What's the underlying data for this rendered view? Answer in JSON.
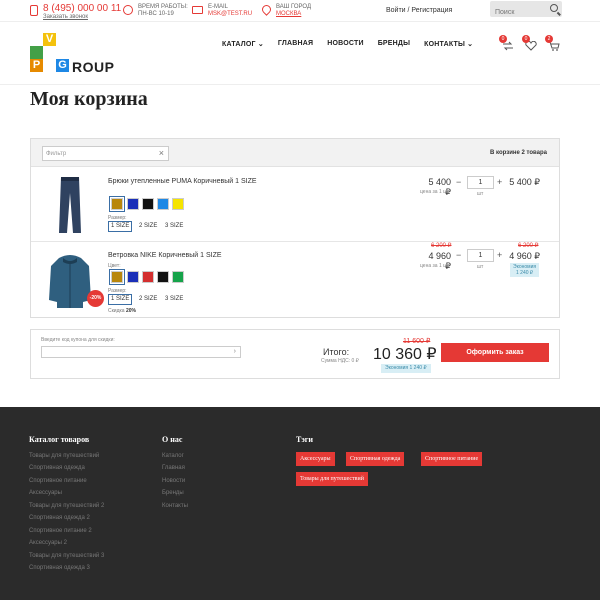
{
  "topbar": {
    "phone": "8 (495) 000 00 11",
    "callback": "Заказать звонок",
    "hours_label": "ВРЕМЯ РАБОТЫ:",
    "hours_value": "ПН-ВС 10-19",
    "email_label": "E-MAIL",
    "email_value": "MSK@TEST.RU",
    "city_label": "ВАШ ГОРОД",
    "city_value": "МОСКВА",
    "login": "Войти / Регистрация",
    "search_placeholder": "Поиск"
  },
  "logo": {
    "letters": [
      "V",
      "P",
      "G"
    ],
    "rest": "ROUP",
    "colors": [
      "#f4c20d",
      "#e68a00",
      "#1e88e5",
      "#43a047"
    ]
  },
  "nav": [
    "КАТАЛОГ",
    "ГЛАВНАЯ",
    "НОВОСТИ",
    "БРЕНДЫ",
    "КОНТАКТЫ"
  ],
  "header_icons": {
    "compare_count": "0",
    "wishlist_count": "0",
    "cart_count": "2"
  },
  "page": {
    "title": "Моя корзина"
  },
  "cart": {
    "filter_placeholder": "Фильтр",
    "count_label": "В корзине 2 товара",
    "color_label": "Цвет:",
    "size_label": "Размер:",
    "items": [
      {
        "name": "Брюки утепленные PUMA Коричневый 1 SIZE",
        "colors": [
          "#b8860b",
          "#1a2fb8",
          "#111111",
          "#1e88e5",
          "#f5e400"
        ],
        "sizes": [
          "1 SIZE",
          "2 SIZE",
          "3 SIZE"
        ],
        "price": "5 400 ₽",
        "unit_price_label": "цена за 1 шт",
        "qty": "1",
        "unit": "шт",
        "sum": "5 400 ₽"
      },
      {
        "name": "Ветровка NIKE Коричневый 1 SIZE",
        "colors": [
          "#b8860b",
          "#1a2fb8",
          "#d32f2f",
          "#111111",
          "#16a34a"
        ],
        "sizes": [
          "1 SIZE",
          "2 SIZE",
          "3 SIZE"
        ],
        "old_price": "6 200 ₽",
        "price": "4 960 ₽",
        "unit_price_label": "цена за 1 шт",
        "qty": "1",
        "unit": "шт",
        "old_sum": "6 200 ₽",
        "sum": "4 960 ₽",
        "economy": "Экономия\n1 240 ₽",
        "discount_badge": "-20%",
        "discount_label": "Скидка",
        "discount_value": "20%"
      }
    ]
  },
  "total": {
    "coupon_label": "Введите код купона для скидки:",
    "label": "Итого:",
    "vat": "Сумма НДС: 0 ₽",
    "old": "11 600 ₽",
    "value": "10 360 ₽",
    "economy": "Экономия 1 240 ₽",
    "checkout": "Оформить заказ"
  },
  "footer": {
    "catalog_title": "Каталог товаров",
    "catalog_links": [
      "Товары для путешествий",
      "Спортивная одежда",
      "Спортивное питание",
      "Аксессуары",
      "Товары для путешествий 2",
      "Спортивная одежда 2",
      "Спортивное питание 2",
      "Аксессуары 2",
      "Товары для путешествий 3",
      "Спортивная одежда 3"
    ],
    "about_title": "О нас",
    "about_links": [
      "Каталог",
      "Главная",
      "Новости",
      "Бренды",
      "Контакты"
    ],
    "tags_title": "Тэги",
    "tags": [
      "Аксессуары",
      "Спортивная одежда",
      "Спортивное питание",
      "Товары для путешествий"
    ]
  }
}
